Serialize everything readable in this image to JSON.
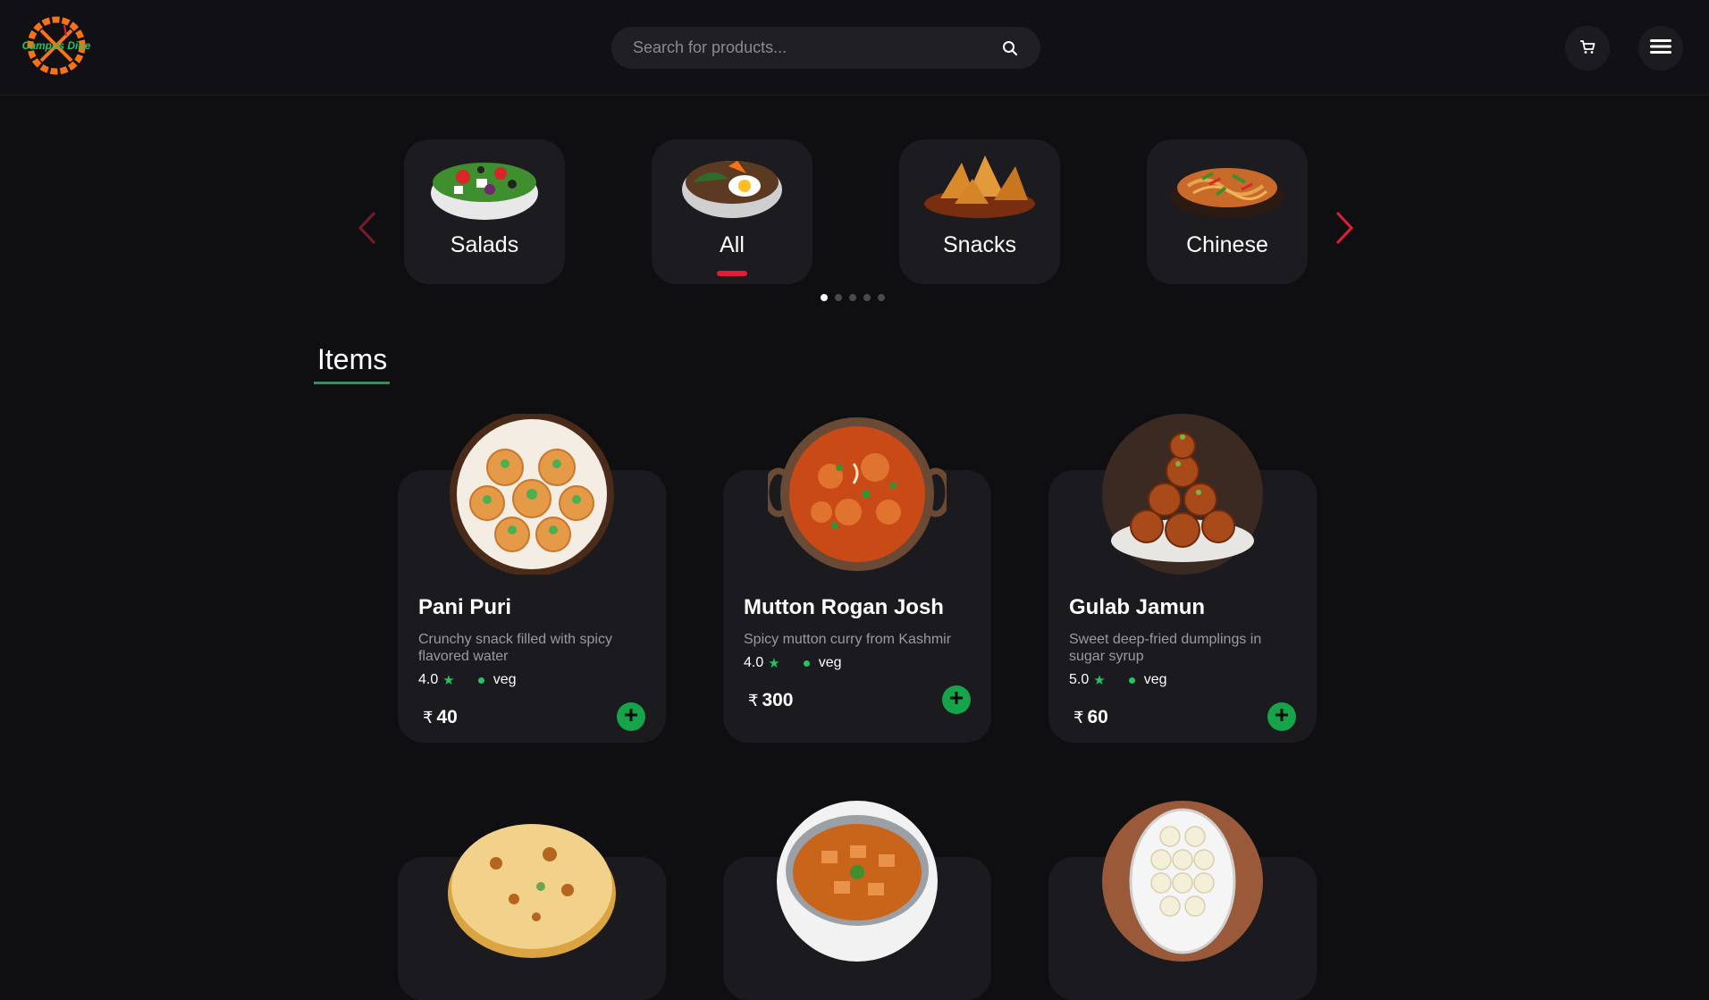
{
  "header": {
    "logo_text": "Campus Dine",
    "search_placeholder": "Search for products..."
  },
  "categories": [
    {
      "label": "Salads",
      "icon": "salad-bowl-image",
      "active": false
    },
    {
      "label": "All",
      "icon": "mixed-bowl-image",
      "active": true
    },
    {
      "label": "Snacks",
      "icon": "samosa-plate-image",
      "active": false
    },
    {
      "label": "Chinese",
      "icon": "noodles-plate-image",
      "active": false
    }
  ],
  "carousel_pages": 5,
  "carousel_active_page": 1,
  "items_title": "Items",
  "items": [
    {
      "name": "Pani Puri",
      "description": "Crunchy snack filled with spicy flavored water",
      "rating": "4.0",
      "type": "veg",
      "currency": "₹",
      "price": "40"
    },
    {
      "name": "Mutton Rogan Josh",
      "description": "Spicy mutton curry from Kashmir",
      "rating": "4.0",
      "type": "veg",
      "currency": "₹",
      "price": "300"
    },
    {
      "name": "Gulab Jamun",
      "description": "Sweet deep-fried dumplings in sugar syrup",
      "rating": "5.0",
      "type": "veg",
      "currency": "₹",
      "price": "60"
    }
  ],
  "colors": {
    "background": "#0f0f12",
    "card": "#1a1a1f",
    "accent_red": "#e11d3a",
    "accent_green": "#22c55e",
    "add_button": "#16a34a"
  }
}
